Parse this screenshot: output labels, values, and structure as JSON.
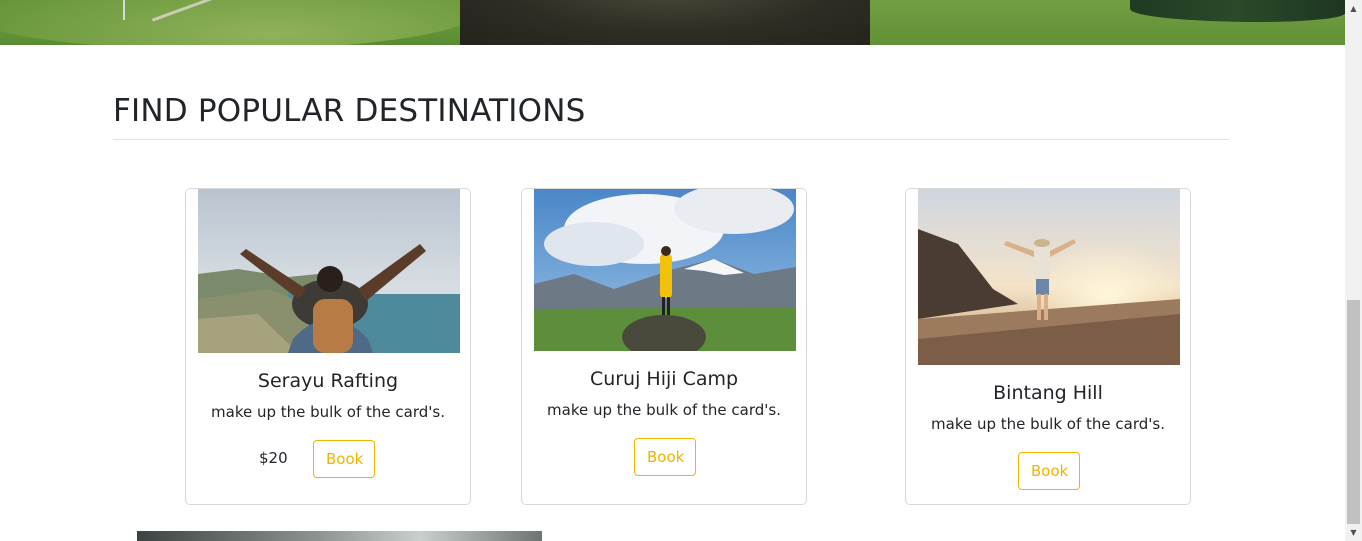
{
  "section": {
    "title": "FIND POPULAR DESTINATIONS"
  },
  "cards": [
    {
      "title": "Serayu Rafting",
      "text": "make up the bulk of the card's.",
      "price": "$20",
      "button": "Book"
    },
    {
      "title": "Curuj Hiji Camp",
      "text": "make up the bulk of the card's.",
      "button": "Book"
    },
    {
      "title": "Bintang Hill",
      "text": "make up the bulk of the card's.",
      "button": "Book"
    }
  ],
  "colors": {
    "accent": "#f0b400",
    "border": "#d9d9d9",
    "text": "#212529"
  }
}
